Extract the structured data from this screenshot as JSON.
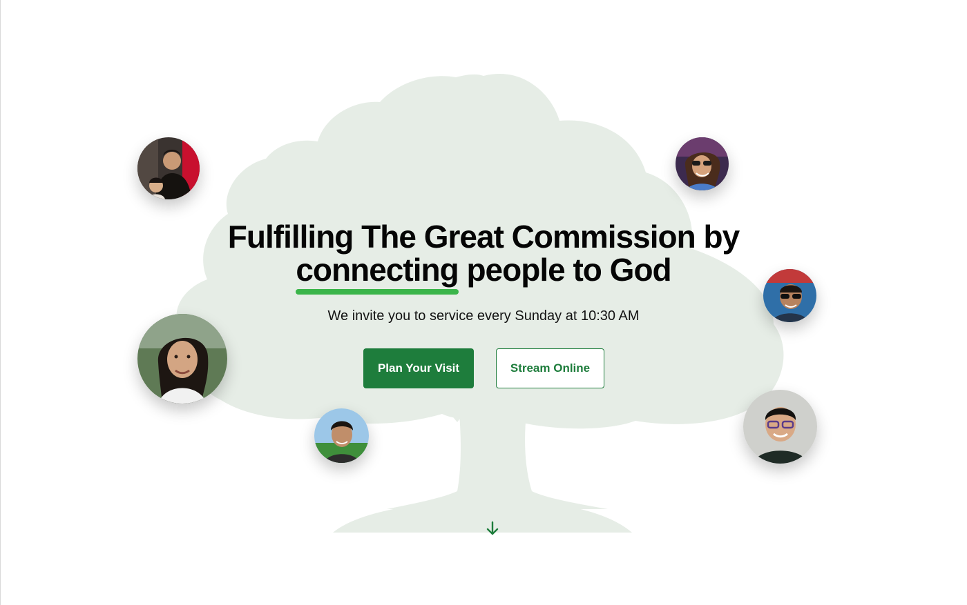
{
  "hero": {
    "headline_line1": "Fulfilling The Great Commission by",
    "headline_highlight": "connecting",
    "headline_rest": "people to God",
    "subtitle": "We invite you to service every Sunday at 10:30 AM"
  },
  "actions": {
    "plan_visit_label": "Plan Your Visit",
    "stream_online_label": "Stream Online"
  },
  "icons": {
    "scroll": "arrow-down-icon",
    "background": "tree-icon"
  },
  "colors": {
    "accent": "#1e7d3c",
    "highlight": "#3bb54a",
    "tree": "#e6ede6",
    "text": "#050505"
  }
}
